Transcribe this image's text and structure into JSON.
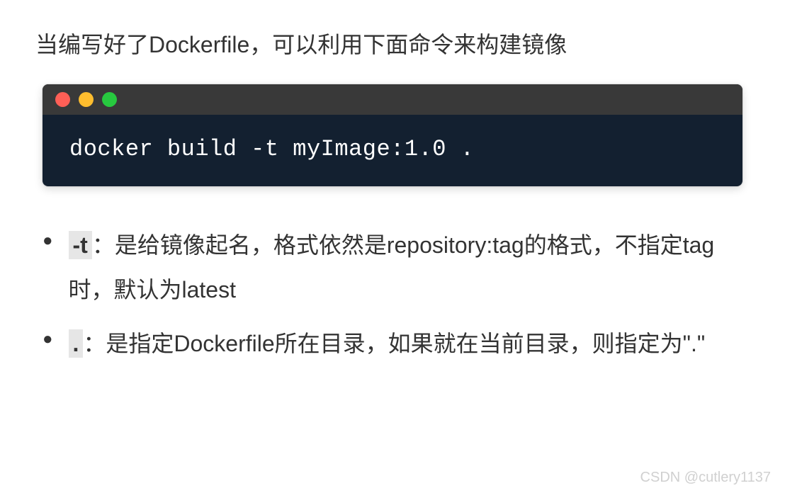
{
  "intro": "当编写好了Dockerfile，可以利用下面命令来构建镜像",
  "terminal": {
    "command": "docker build -t myImage:1.0 ."
  },
  "bullets": [
    {
      "code": "-t",
      "text_prefix": "：是给镜像起名，格式依然是repository:tag的格式，不指定tag时，默认为latest"
    },
    {
      "code": ".",
      "text_prefix": "：是指定Dockerfile所在目录，如果就在当前目录，则指定为\".\""
    }
  ],
  "watermark": "CSDN @cutlery1137"
}
